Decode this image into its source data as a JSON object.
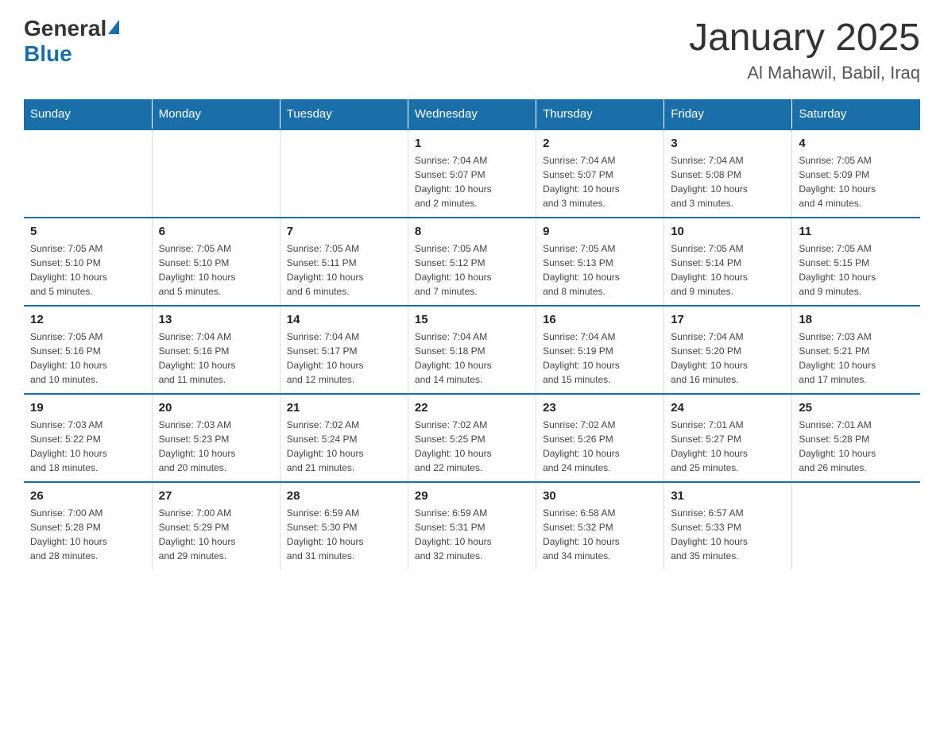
{
  "header": {
    "logo_general": "General",
    "logo_blue": "Blue",
    "month_title": "January 2025",
    "location": "Al Mahawil, Babil, Iraq"
  },
  "weekdays": [
    "Sunday",
    "Monday",
    "Tuesday",
    "Wednesday",
    "Thursday",
    "Friday",
    "Saturday"
  ],
  "weeks": [
    [
      {
        "day": "",
        "info": ""
      },
      {
        "day": "",
        "info": ""
      },
      {
        "day": "",
        "info": ""
      },
      {
        "day": "1",
        "info": "Sunrise: 7:04 AM\nSunset: 5:07 PM\nDaylight: 10 hours\nand 2 minutes."
      },
      {
        "day": "2",
        "info": "Sunrise: 7:04 AM\nSunset: 5:07 PM\nDaylight: 10 hours\nand 3 minutes."
      },
      {
        "day": "3",
        "info": "Sunrise: 7:04 AM\nSunset: 5:08 PM\nDaylight: 10 hours\nand 3 minutes."
      },
      {
        "day": "4",
        "info": "Sunrise: 7:05 AM\nSunset: 5:09 PM\nDaylight: 10 hours\nand 4 minutes."
      }
    ],
    [
      {
        "day": "5",
        "info": "Sunrise: 7:05 AM\nSunset: 5:10 PM\nDaylight: 10 hours\nand 5 minutes."
      },
      {
        "day": "6",
        "info": "Sunrise: 7:05 AM\nSunset: 5:10 PM\nDaylight: 10 hours\nand 5 minutes."
      },
      {
        "day": "7",
        "info": "Sunrise: 7:05 AM\nSunset: 5:11 PM\nDaylight: 10 hours\nand 6 minutes."
      },
      {
        "day": "8",
        "info": "Sunrise: 7:05 AM\nSunset: 5:12 PM\nDaylight: 10 hours\nand 7 minutes."
      },
      {
        "day": "9",
        "info": "Sunrise: 7:05 AM\nSunset: 5:13 PM\nDaylight: 10 hours\nand 8 minutes."
      },
      {
        "day": "10",
        "info": "Sunrise: 7:05 AM\nSunset: 5:14 PM\nDaylight: 10 hours\nand 9 minutes."
      },
      {
        "day": "11",
        "info": "Sunrise: 7:05 AM\nSunset: 5:15 PM\nDaylight: 10 hours\nand 9 minutes."
      }
    ],
    [
      {
        "day": "12",
        "info": "Sunrise: 7:05 AM\nSunset: 5:16 PM\nDaylight: 10 hours\nand 10 minutes."
      },
      {
        "day": "13",
        "info": "Sunrise: 7:04 AM\nSunset: 5:16 PM\nDaylight: 10 hours\nand 11 minutes."
      },
      {
        "day": "14",
        "info": "Sunrise: 7:04 AM\nSunset: 5:17 PM\nDaylight: 10 hours\nand 12 minutes."
      },
      {
        "day": "15",
        "info": "Sunrise: 7:04 AM\nSunset: 5:18 PM\nDaylight: 10 hours\nand 14 minutes."
      },
      {
        "day": "16",
        "info": "Sunrise: 7:04 AM\nSunset: 5:19 PM\nDaylight: 10 hours\nand 15 minutes."
      },
      {
        "day": "17",
        "info": "Sunrise: 7:04 AM\nSunset: 5:20 PM\nDaylight: 10 hours\nand 16 minutes."
      },
      {
        "day": "18",
        "info": "Sunrise: 7:03 AM\nSunset: 5:21 PM\nDaylight: 10 hours\nand 17 minutes."
      }
    ],
    [
      {
        "day": "19",
        "info": "Sunrise: 7:03 AM\nSunset: 5:22 PM\nDaylight: 10 hours\nand 18 minutes."
      },
      {
        "day": "20",
        "info": "Sunrise: 7:03 AM\nSunset: 5:23 PM\nDaylight: 10 hours\nand 20 minutes."
      },
      {
        "day": "21",
        "info": "Sunrise: 7:02 AM\nSunset: 5:24 PM\nDaylight: 10 hours\nand 21 minutes."
      },
      {
        "day": "22",
        "info": "Sunrise: 7:02 AM\nSunset: 5:25 PM\nDaylight: 10 hours\nand 22 minutes."
      },
      {
        "day": "23",
        "info": "Sunrise: 7:02 AM\nSunset: 5:26 PM\nDaylight: 10 hours\nand 24 minutes."
      },
      {
        "day": "24",
        "info": "Sunrise: 7:01 AM\nSunset: 5:27 PM\nDaylight: 10 hours\nand 25 minutes."
      },
      {
        "day": "25",
        "info": "Sunrise: 7:01 AM\nSunset: 5:28 PM\nDaylight: 10 hours\nand 26 minutes."
      }
    ],
    [
      {
        "day": "26",
        "info": "Sunrise: 7:00 AM\nSunset: 5:28 PM\nDaylight: 10 hours\nand 28 minutes."
      },
      {
        "day": "27",
        "info": "Sunrise: 7:00 AM\nSunset: 5:29 PM\nDaylight: 10 hours\nand 29 minutes."
      },
      {
        "day": "28",
        "info": "Sunrise: 6:59 AM\nSunset: 5:30 PM\nDaylight: 10 hours\nand 31 minutes."
      },
      {
        "day": "29",
        "info": "Sunrise: 6:59 AM\nSunset: 5:31 PM\nDaylight: 10 hours\nand 32 minutes."
      },
      {
        "day": "30",
        "info": "Sunrise: 6:58 AM\nSunset: 5:32 PM\nDaylight: 10 hours\nand 34 minutes."
      },
      {
        "day": "31",
        "info": "Sunrise: 6:57 AM\nSunset: 5:33 PM\nDaylight: 10 hours\nand 35 minutes."
      },
      {
        "day": "",
        "info": ""
      }
    ]
  ]
}
